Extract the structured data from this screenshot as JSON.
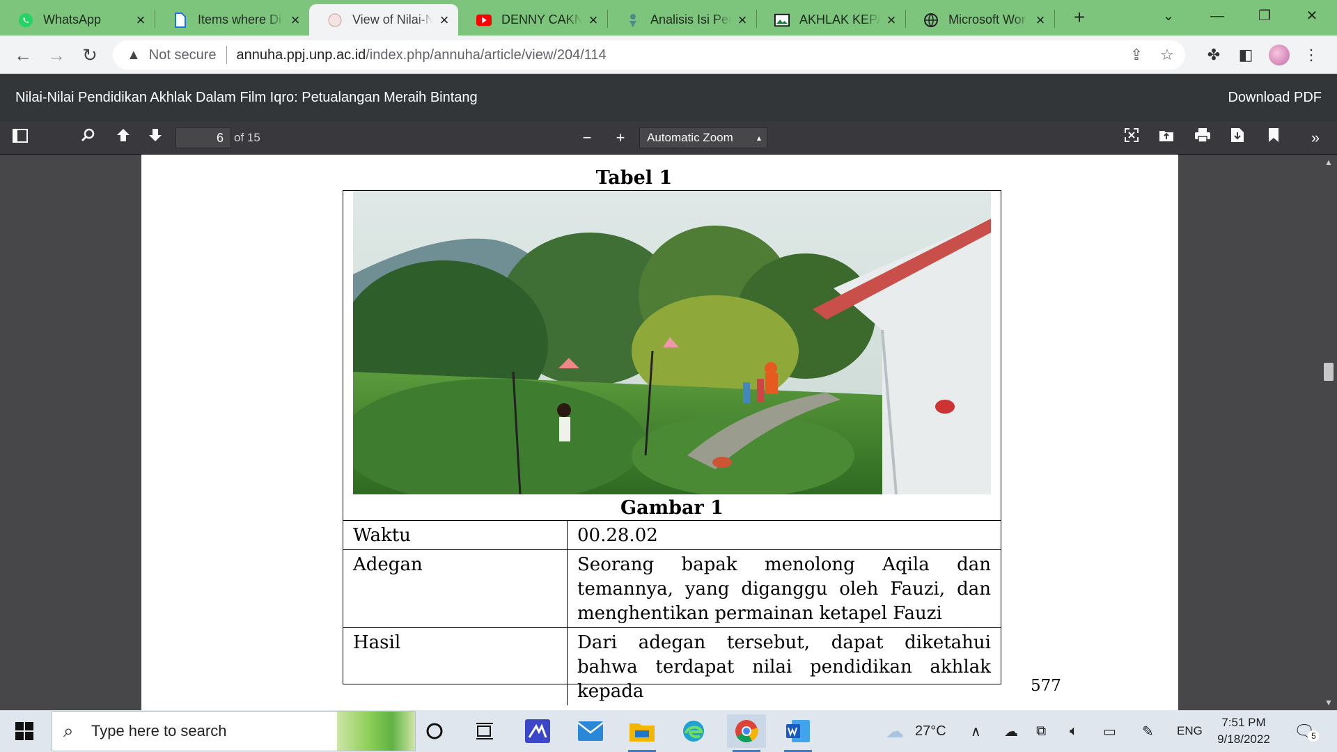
{
  "browser": {
    "tabs": [
      {
        "title": "WhatsApp",
        "icon": "whatsapp-icon"
      },
      {
        "title": "Items where Di",
        "icon": "document-icon"
      },
      {
        "title": "View of Nilai-N",
        "icon": "journal-icon",
        "active": true
      },
      {
        "title": "DENNY CAKNA",
        "icon": "youtube-icon"
      },
      {
        "title": "Analisis Isi Pen",
        "icon": "scholar-icon"
      },
      {
        "title": "AKHLAK KEPAD",
        "icon": "image-icon"
      },
      {
        "title": "Microsoft Wor",
        "icon": "globe-icon"
      }
    ],
    "new_tab": "+",
    "address": {
      "security_label": "Not secure",
      "host": "annuha.ppj.unp.ac.id",
      "path": "/index.php/annuha/article/view/204/114"
    }
  },
  "pdf": {
    "title": "Nilai-Nilai Pendidikan Akhlak Dalam Film Iqro: Petualangan Meraih Bintang",
    "download_label": "Download PDF",
    "current_page": "6",
    "page_count_label": "of 15",
    "zoom_label": "Automatic Zoom"
  },
  "document": {
    "table_caption": "Tabel 1",
    "figure_caption": "Gambar 1",
    "rows": [
      {
        "key": "Waktu",
        "value": "00.28.02"
      },
      {
        "key": "Adegan",
        "value": "Seorang bapak menolong Aqila dan temannya, yang diganggu oleh Fauzi, dan menghentikan permainan ketapel Fauzi"
      },
      {
        "key": "Hasil",
        "value": "Dari adegan tersebut, dapat diketahui bahwa terdapat nilai pendidikan akhlak kepada"
      }
    ],
    "page_number": "577"
  },
  "taskbar": {
    "search_placeholder": "Type here to search",
    "weather": "27°C",
    "language": "ENG",
    "time": "7:51 PM",
    "date": "9/18/2022",
    "notification_count": "5"
  },
  "colors": {
    "tabstrip": "#7dc47c",
    "pdf_chrome": "#323639",
    "viewer_bg": "#474749",
    "taskbar": "#dfe6ee"
  }
}
